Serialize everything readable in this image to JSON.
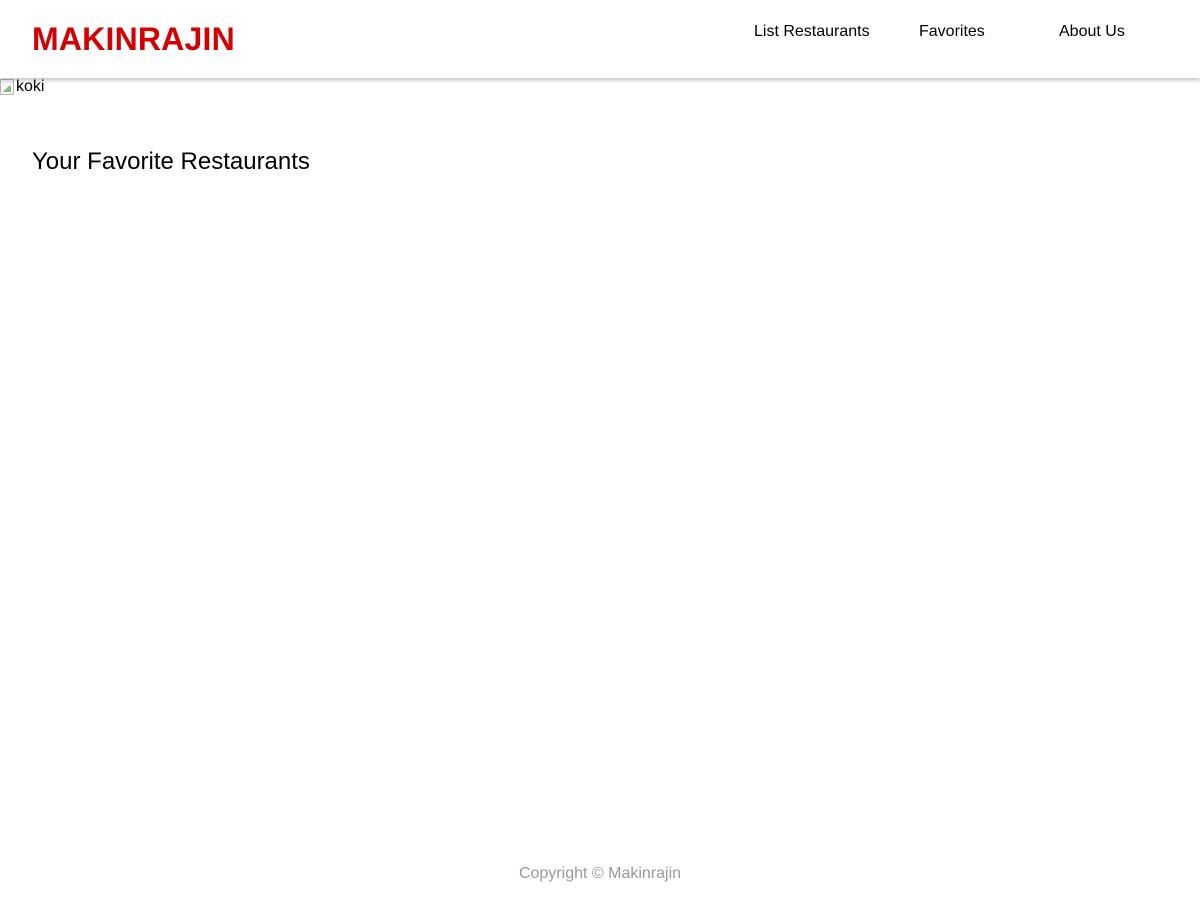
{
  "header": {
    "brand": "MAKINRAJIN",
    "nav": [
      {
        "label": "List Restaurants"
      },
      {
        "label": "Favorites"
      },
      {
        "label": "About Us"
      }
    ]
  },
  "hero": {
    "image_alt": "koki"
  },
  "main": {
    "title": "Your Favorite Restaurants"
  },
  "footer": {
    "copyright": "Copyright © Makinrajin"
  },
  "colors": {
    "brand": "#d50000",
    "text": "#000000",
    "footer_text": "#999999",
    "background": "#ffffff"
  },
  "icons": {
    "hero": "broken-image-icon"
  }
}
